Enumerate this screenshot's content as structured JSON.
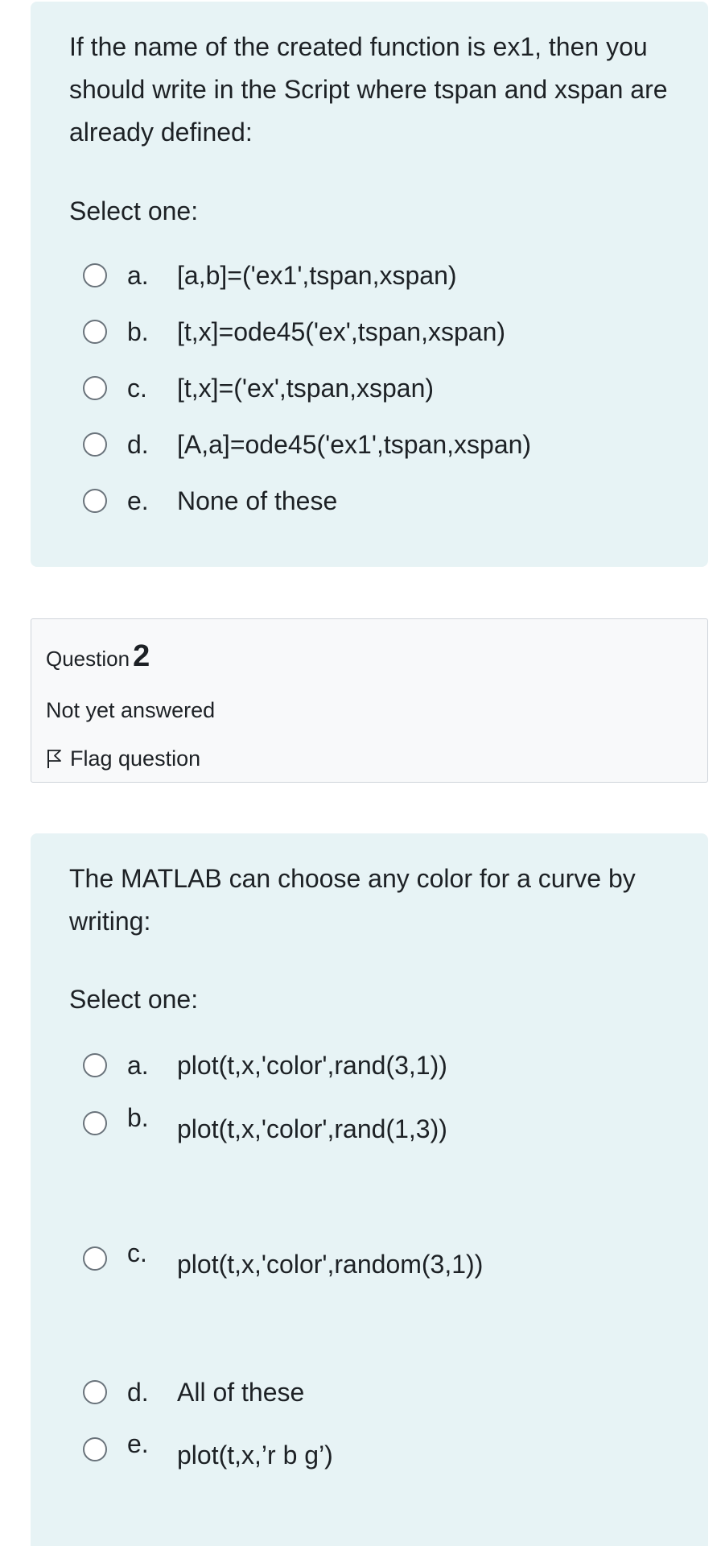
{
  "question1": {
    "text": "If the name of the created function is ex1, then you should write in the Script where tspan and xspan are already defined:",
    "prompt": "Select one:",
    "options": [
      {
        "letter": "a.",
        "text": "[a,b]=('ex1',tspan,xspan)"
      },
      {
        "letter": "b.",
        "text": "[t,x]=ode45('ex',tspan,xspan)"
      },
      {
        "letter": "c.",
        "text": "[t,x]=('ex',tspan,xspan)"
      },
      {
        "letter": "d.",
        "text": "[A,a]=ode45('ex1',tspan,xspan)"
      },
      {
        "letter": "e.",
        "text": "None of these"
      }
    ]
  },
  "question2_info": {
    "label": "Question",
    "number": "2",
    "state": "Not yet answered",
    "flag_label": "Flag question",
    "flag_icon": "flag-icon"
  },
  "question2": {
    "text": "The MATLAB can choose any color for a curve by writing:",
    "prompt": "Select one:",
    "options": [
      {
        "letter": "a.",
        "text": "plot(t,x,'color',rand(3,1))"
      },
      {
        "letter": "b.",
        "text": "plot(t,x,'color',rand(1,3))"
      },
      {
        "letter": "c.",
        "text": "plot(t,x,'color',random(3,1))"
      },
      {
        "letter": "d.",
        "text": "All of these"
      },
      {
        "letter": "e.",
        "text": "plot(t,x,’r b g’)"
      }
    ]
  },
  "colors": {
    "question_background": "#e7f3f5",
    "info_background": "#f8f9fa",
    "text": "#1d2125",
    "radio_border": "#6a737b"
  }
}
